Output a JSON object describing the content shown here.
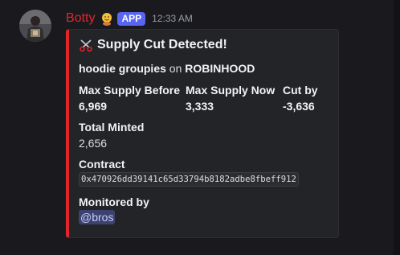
{
  "message": {
    "author": "Botty",
    "author_color": "#e3242b",
    "app_badge": "APP",
    "timestamp": "12:33 AM",
    "avatar_icon": "user-avatar-icon",
    "role_icon": "emoji-badge-icon"
  },
  "embed": {
    "accent_color": "#e3242b",
    "title_icon": "scissors-icon",
    "title": "Supply Cut Detected!",
    "description": {
      "collection": "hoodie groupies",
      "connector": "on",
      "marketplace": "ROBINHOOD"
    },
    "fields": {
      "max_supply_before": {
        "name": "Max Supply Before",
        "value": "6,969"
      },
      "max_supply_now": {
        "name": "Max Supply Now",
        "value": "3,333"
      },
      "cut_by": {
        "name": "Cut by",
        "value": "-3,636"
      },
      "total_minted": {
        "name": "Total Minted",
        "value": "2,656"
      },
      "contract": {
        "name": "Contract",
        "value": "0x470926dd39141c65d33794b8182adbe8fbeff912"
      },
      "monitored_by": {
        "name": "Monitored by",
        "value": "@bros"
      }
    }
  }
}
